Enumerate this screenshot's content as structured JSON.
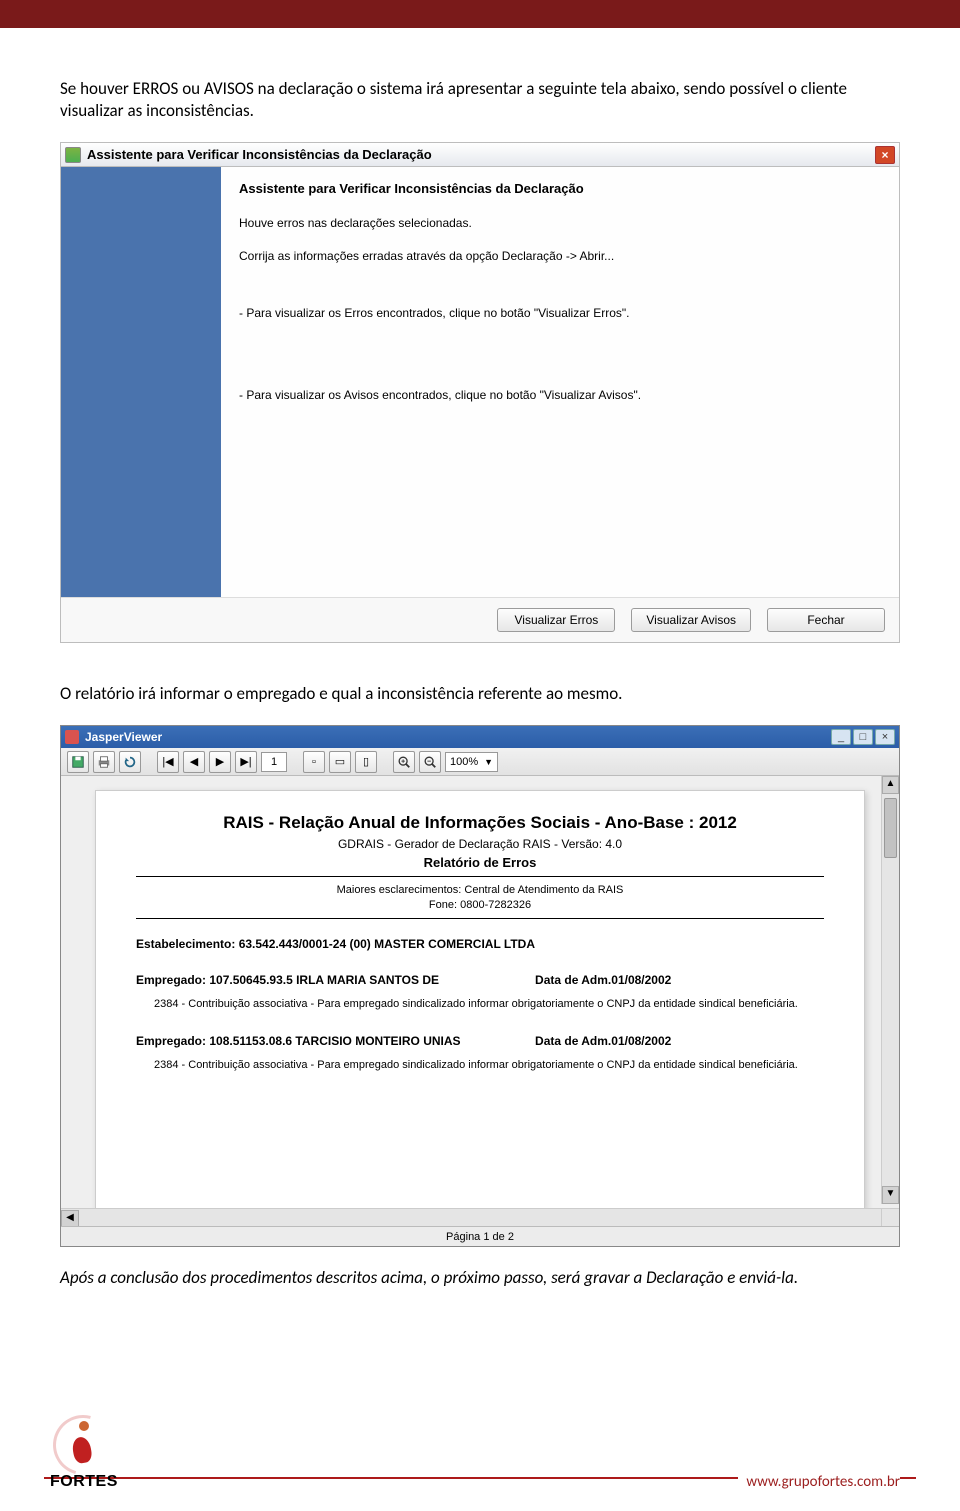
{
  "paragraphs": {
    "intro": "Se houver ERROS ou AVISOS na declaração o sistema irá apresentar a seguinte tela abaixo, sendo possível o cliente visualizar as inconsistências.",
    "mid": "O relatório irá informar o empregado e qual a inconsistência referente ao mesmo.",
    "outro": "Após a conclusão dos procedimentos descritos acima, o próximo passo, será gravar a Declaração e enviá-la."
  },
  "wizard": {
    "titlebar": "Assistente para Verificar Inconsistências da Declaração",
    "close": "×",
    "heading": "Assistente para Verificar Inconsistências da Declaração",
    "msg1": "Houve erros nas declarações selecionadas.",
    "msg2": "Corrija as informações erradas através da opção Declaração -> Abrir...",
    "msg3": "- Para visualizar os Erros encontrados, clique no botão \"Visualizar Erros\".",
    "msg4": "- Para visualizar os Avisos encontrados, clique no botão \"Visualizar Avisos\".",
    "btn_errors": "Visualizar Erros",
    "btn_warn": "Visualizar Avisos",
    "btn_close": "Fechar"
  },
  "viewer": {
    "title": "JasperViewer",
    "min": "_",
    "max": "□",
    "close": "×",
    "page": "1",
    "zoom": "100%",
    "status": "Página 1 de 2"
  },
  "report": {
    "title": "RAIS - Relação Anual de Informações Sociais - Ano-Base : 2012",
    "sub": "GDRAIS - Gerador de Declaração RAIS - Versão: 4.0",
    "sub2": "Relatório de Erros",
    "info1": "Maiores esclarecimentos: Central de Atendimento da RAIS",
    "info2": "Fone: 0800-7282326",
    "estab": "Estabelecimento: 63.542.443/0001-24  (00)   MASTER COMERCIAL LTDA",
    "emp1_label": "Empregado: 107.50645.93.5   IRLA MARIA SANTOS DE",
    "emp1_date": "Data de Adm.01/08/2002",
    "emp1_desc": "2384 - Contribuição associativa - Para empregado sindicalizado informar obrigatoriamente o CNPJ da entidade sindical beneficiária.",
    "emp2_label": "Empregado: 108.51153.08.6   TARCISIO MONTEIRO UNIAS",
    "emp2_date": "Data de Adm.01/08/2002",
    "emp2_desc": "2384 - Contribuição associativa - Para empregado sindicalizado informar obrigatoriamente o CNPJ da entidade sindical beneficiária."
  },
  "footer": {
    "brand": "FORTES",
    "url": "www.grupofortes.com.br"
  },
  "icons": {
    "save": "save-icon",
    "print": "print-icon",
    "reload": "reload-icon",
    "first": "|◀",
    "prev": "◀",
    "next": "▶",
    "last": "▶|",
    "fitpage": "▭",
    "fitwidth": "▯",
    "actual": "▫",
    "zoomin": "+",
    "zoomout": "−",
    "up": "▲",
    "down": "▼",
    "left": "◀",
    "right": "▶"
  }
}
